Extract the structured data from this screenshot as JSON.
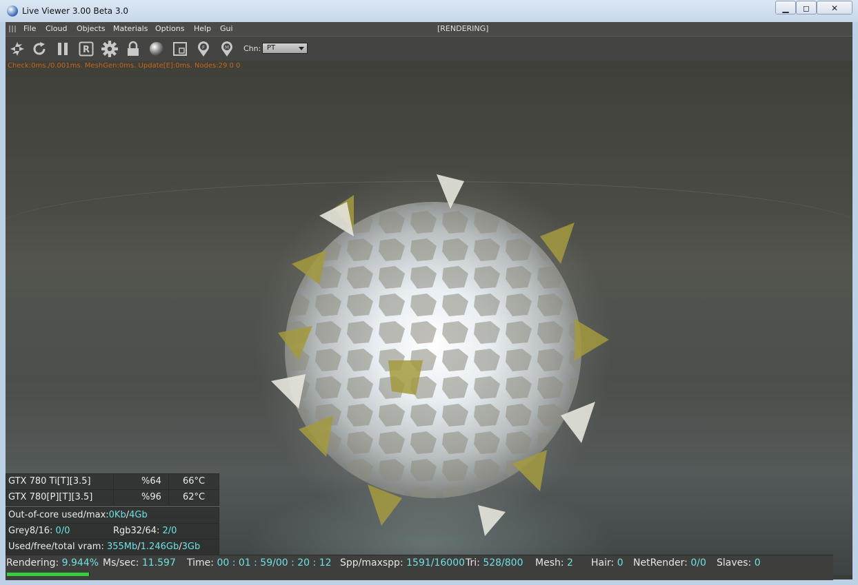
{
  "window": {
    "title": "Live Viewer 3.00 Beta 3.0",
    "controls": {
      "minimize": "▁",
      "maximize": "◻",
      "close": "✕"
    }
  },
  "menu": {
    "items": [
      "File",
      "Cloud",
      "Objects",
      "Materials",
      "Options",
      "Help",
      "Gui"
    ],
    "status": "[RENDERING]"
  },
  "toolbar": {
    "icons": [
      "aperture-icon",
      "refresh-icon",
      "pause-icon",
      "r-box-icon",
      "gear-icon",
      "lock-icon",
      "material-ball-icon",
      "region-icon",
      "focus-pin-icon",
      "material-pin-icon"
    ],
    "chn_label": "Chn:",
    "chn_value": "PT"
  },
  "viewport": {
    "stats_line": "Check:0ms./0.001ms. MeshGen:0ms. Update[E]:0ms. Nodes:29  0 0"
  },
  "gpus": [
    {
      "name": "GTX 780 Ti[T][3.5]",
      "load": "%64",
      "temp": "66°C"
    },
    {
      "name": "GTX 780[P][T][3.5]",
      "load": "%96",
      "temp": "62°C"
    }
  ],
  "memory": {
    "ooc_label": "Out-of-core used/max:",
    "ooc_used": "0Kb",
    "ooc_sep": "/",
    "ooc_max": "4Gb",
    "grey_label": "Grey8/16:",
    "grey_value": "0/0",
    "rgb_label": "Rgb32/64:",
    "rgb_value": "2/0",
    "vram_label": "Used/free/total vram:",
    "vram_used": "355Mb",
    "vram_sep1": "/",
    "vram_free": "1.246Gb",
    "vram_sep2": "/",
    "vram_total": "3Gb"
  },
  "status": {
    "rendering_label": "Rendering:",
    "rendering_value": "9.944%",
    "rendering_progress": 0.0994,
    "mssec_label": "Ms/sec:",
    "mssec_value": "11.597",
    "time_label": "Time:",
    "time_value": "00 : 01 : 59/00 : 20 : 12",
    "spp_label": "Spp/maxspp:",
    "spp_value": "1591/16000",
    "tri_label": "Tri:",
    "tri_value": "528/800",
    "mesh_label": "Mesh:",
    "mesh_value": "2",
    "hair_label": "Hair:",
    "hair_value": "0",
    "netrender_label": "NetRender:",
    "netrender_value": "0/0",
    "slaves_label": "Slaves:",
    "slaves_value": "0"
  },
  "colors": {
    "highlight": "#6ee0e2",
    "stats_orange": "#c8651a",
    "progress_green": "#36d03c"
  }
}
